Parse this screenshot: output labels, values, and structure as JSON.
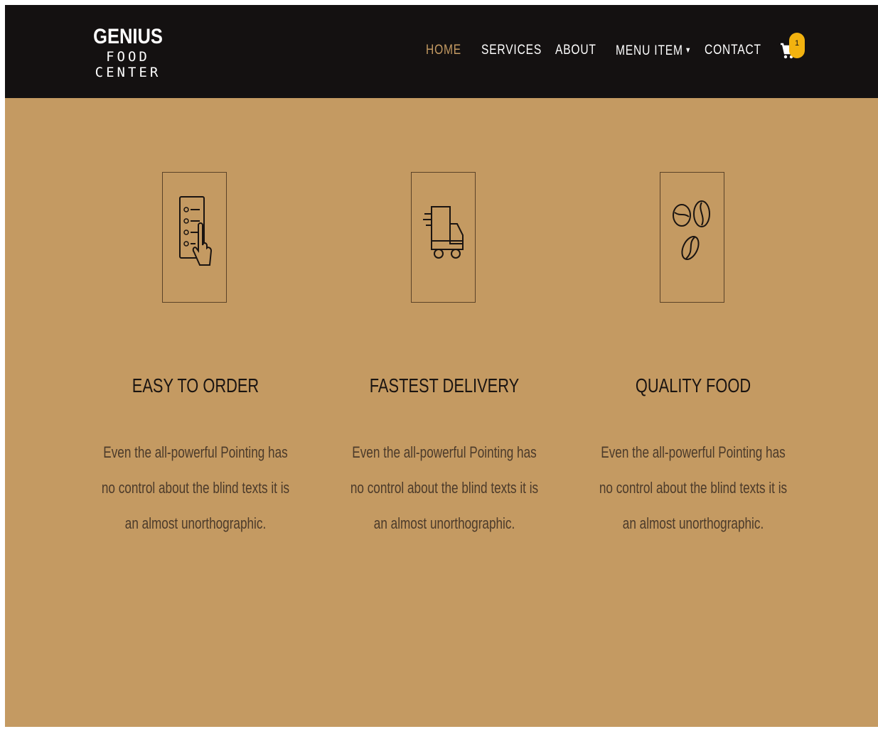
{
  "brand": {
    "line1": "GENIUS",
    "line2": "FOOD CENTER"
  },
  "nav": {
    "items": [
      {
        "label": "HOME",
        "active": true
      },
      {
        "label": "SERVICES",
        "active": false
      },
      {
        "label": "ABOUT",
        "active": false
      },
      {
        "label": "MENU ITEM",
        "active": false,
        "dropdown": true
      },
      {
        "label": "CONTACT",
        "active": false
      }
    ],
    "cart_icon": "cart-icon",
    "cart_count": "1"
  },
  "features": [
    {
      "icon": "checklist-tap-icon",
      "title": "EASY TO ORDER",
      "description": "Even the all-powerful Pointing has no control about the blind texts it is an almost unorthographic."
    },
    {
      "icon": "delivery-truck-icon",
      "title": "FASTEST DELIVERY",
      "description": "Even the all-powerful Pointing has no control about the blind texts it is an almost unorthographic."
    },
    {
      "icon": "coffee-beans-icon",
      "title": "QUALITY FOOD",
      "description": "Even the all-powerful Pointing has no control about the blind texts it is an almost unorthographic."
    }
  ],
  "colors": {
    "navbar": "#141111",
    "background": "#c49a62",
    "accent": "#c49a62",
    "badge": "#f2b20f",
    "text_dark": "#1a1411"
  }
}
